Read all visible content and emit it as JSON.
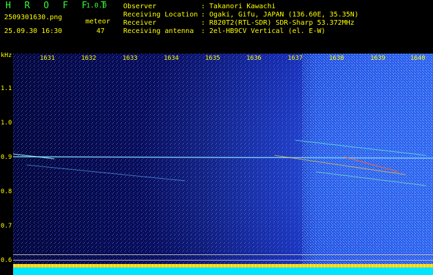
{
  "app": {
    "name": "H R O F F T",
    "version": "1.0.0"
  },
  "capture": {
    "filename": "2509301630.png",
    "datetime": "25.09.30 16:30"
  },
  "meteor": {
    "label": "meteor",
    "count": "47"
  },
  "info": [
    {
      "key": "Observer",
      "value": ": Takanori Kawachi"
    },
    {
      "key": "Receiving Location",
      "value": ": Ogaki, Gifu, JAPAN (136.60E, 35.35N)"
    },
    {
      "key": "Receiver",
      "value": ": R820T2(RTL-SDR) SDR-Sharp 53.372MHz"
    },
    {
      "key": "Receiving antenna",
      "value": ": 2el-HB9CV Vertical (el. E-W)"
    }
  ],
  "axes": {
    "y_unit": "kHz",
    "y_ticks": [
      "1.1",
      "1.0",
      "0.9",
      "0.8",
      "0.7",
      "0.6"
    ],
    "x_ticks": [
      "1631",
      "1632",
      "1633",
      "1634",
      "1635",
      "1636",
      "1637",
      "1638",
      "1639",
      "1640"
    ]
  },
  "colors": {
    "label": "#ffff00",
    "title": "#33ff33",
    "signal": "#88ddff"
  }
}
